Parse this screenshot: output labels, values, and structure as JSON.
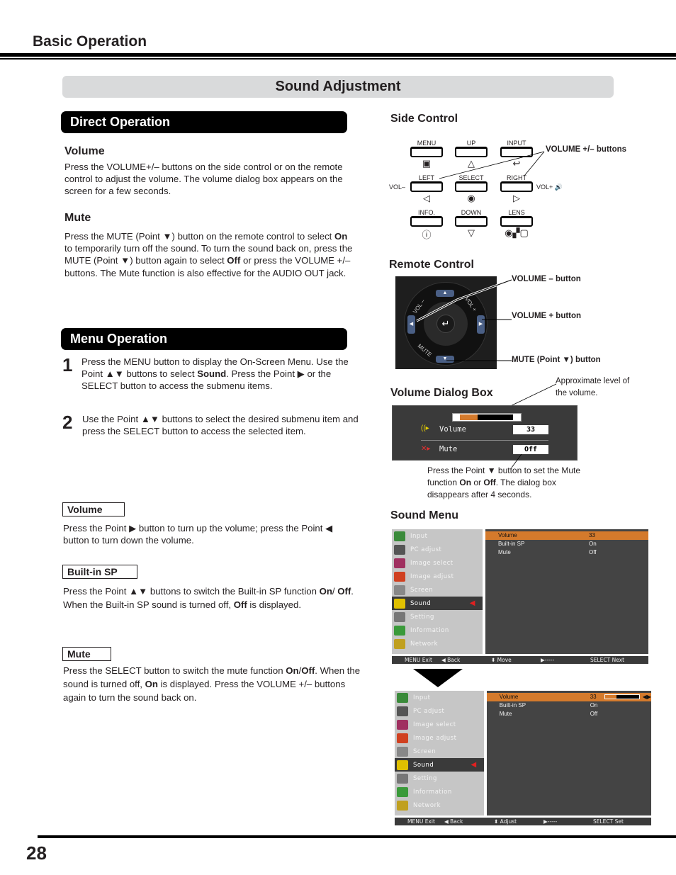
{
  "header": {
    "section_title": "Basic Operation"
  },
  "banner": {
    "title": "Sound Adjustment"
  },
  "direct_operation": {
    "heading": "Direct Operation",
    "volume": {
      "title": "Volume",
      "text": "Press the VOLUME+/– buttons on the side control or on the remote control to adjust the volume. The volume dialog box appears on the screen for a few seconds."
    },
    "mute": {
      "title": "Mute",
      "parts": [
        "Press the MUTE (Point ▼) button on the remote control to select ",
        "On",
        " to temporarily turn off the sound. To turn the sound back on, press the MUTE (Point ▼) button again to select ",
        "Off",
        " or press the VOLUME +/– buttons. The Mute function is also effective for the AUDIO OUT jack."
      ]
    }
  },
  "menu_operation": {
    "heading": "Menu Operation",
    "steps": [
      {
        "num": "1",
        "parts": [
          "Press the MENU button to display the On-Screen Menu. Use the Point ▲▼ buttons to select ",
          "Sound",
          ". Press the Point ▶ or the SELECT button to access the submenu items."
        ]
      },
      {
        "num": "2",
        "parts": [
          "Use the Point ▲▼ buttons to select the desired submenu item and press the SELECT button to access the selected item."
        ]
      }
    ],
    "items": [
      {
        "label": "Volume",
        "parts": [
          "Press the Point ▶ button to turn up the volume; press the Point ◀ button to turn down the volume."
        ]
      },
      {
        "label": "Built-in SP",
        "parts": [
          "Press the Point ▲▼ buttons to switch the Built-in SP function ",
          "On",
          "/ ",
          "Off",
          ". When the Built-in SP sound is turned off, ",
          "Off",
          " is displayed."
        ]
      },
      {
        "label": "Mute",
        "parts": [
          "Press the SELECT button to switch the mute function ",
          "On",
          "/",
          "Off",
          ". When the sound is turned off, ",
          "On",
          " is displayed. Press the VOLUME +/– buttons again to turn the sound back on."
        ]
      }
    ]
  },
  "side_control": {
    "title": "Side Control",
    "buttons": [
      {
        "label": "MENU",
        "symbol": "▣"
      },
      {
        "label": "UP",
        "symbol": "△"
      },
      {
        "label": "INPUT",
        "symbol": "↩"
      },
      {
        "label": "LEFT",
        "symbol": "◁"
      },
      {
        "label": "SELECT",
        "symbol": "◉"
      },
      {
        "label": "RIGHT",
        "symbol": "▷"
      },
      {
        "label": "INFO.",
        "symbol": "ⓘ"
      },
      {
        "label": "DOWN",
        "symbol": "▽"
      },
      {
        "label": "LENS",
        "symbol": "◉▞▢"
      }
    ],
    "vol_minus": "VOL–",
    "vol_plus": "VOL+ 🔊",
    "callout": "VOLUME +/– buttons"
  },
  "remote_control": {
    "title": "Remote Control",
    "ring_labels": {
      "vol_minus": "VOL –",
      "vol_plus": "VOL +",
      "mute": "MUTE"
    },
    "callouts": [
      "VOLUME – button",
      "VOLUME + button",
      "MUTE (Point ▼) button"
    ]
  },
  "volume_dialog": {
    "title": "Volume Dialog Box",
    "level_callout": "Approximate level of the volume.",
    "volume_label": "Volume",
    "volume_value": "33",
    "volume_level_fraction": 0.33,
    "mute_label": "Mute",
    "mute_value": "Off",
    "note_parts": [
      "Press the Point ▼ button to set the Mute function ",
      "On",
      " or ",
      "Off",
      ". The dialog box disappears after 4 seconds."
    ]
  },
  "sound_menu": {
    "title": "Sound Menu",
    "sidebar": [
      "Input",
      "PC adjust",
      "Image select",
      "Image adjust",
      "Screen",
      "Sound",
      "Setting",
      "Information",
      "Network"
    ],
    "selected": "Sound",
    "rows": [
      {
        "name": "Volume",
        "value": "33"
      },
      {
        "name": "Built-in SP",
        "value": "On"
      },
      {
        "name": "Mute",
        "value": "Off"
      }
    ],
    "bar1": [
      "MENU Exit",
      "◀ Back",
      "⬍ Move",
      "▶-----",
      "SELECT Next"
    ],
    "bar2": [
      "MENU Exit",
      "◀ Back",
      "⬍ Adjust",
      "▶-----",
      "SELECT Set"
    ],
    "accent": "#d47a2c",
    "marker_color": "#e02020"
  },
  "page_number": "28"
}
